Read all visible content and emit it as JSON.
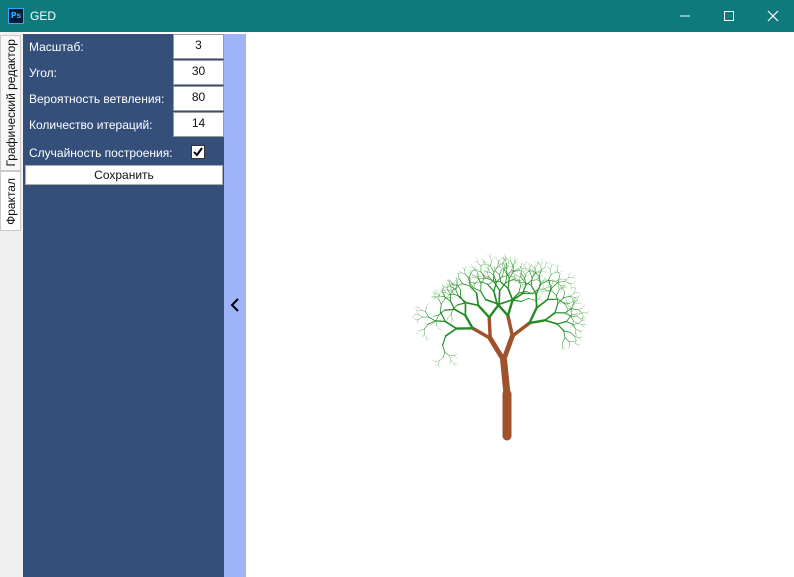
{
  "window": {
    "app_icon_text": "Ps",
    "title": "GED",
    "controls": [
      "minimize-icon",
      "maximize-icon",
      "close-icon"
    ]
  },
  "tabs": [
    {
      "label": "Графический редактор",
      "selected": false
    },
    {
      "label": "Фрактал",
      "selected": true
    }
  ],
  "panel": {
    "scale_label": "Масштаб:",
    "scale_value": "3",
    "angle_label": "Угол:",
    "angle_value": "30",
    "branch_prob_label": "Вероятность ветвления:",
    "branch_prob_value": "80",
    "iterations_label": "Количество итераций:",
    "iterations_value": "14",
    "random_label": "Случайность построения:",
    "random_checked": true,
    "save_label": "Сохранить"
  },
  "splitter": {
    "icon": "chevron-left-icon"
  },
  "colors": {
    "titlebar": "#0f7a7c",
    "panel": "#34507a",
    "splitter": "#9fb4f6",
    "trunk": "#a0522d",
    "foliage": "#228b22"
  }
}
